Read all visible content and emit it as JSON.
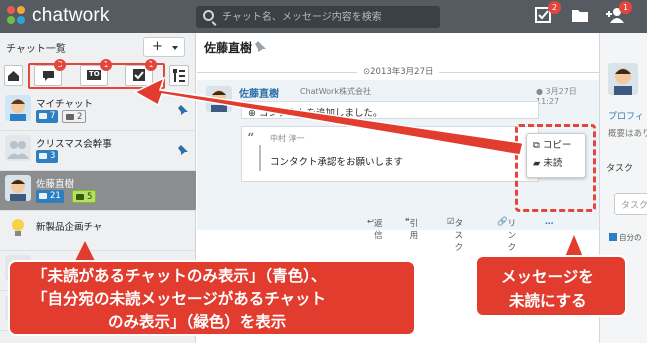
{
  "header": {
    "brand": "chatwork",
    "search_placeholder": "チャット名、メッセージ内容を検索",
    "task_badge": "2",
    "contact_badge": "1"
  },
  "sidebar": {
    "title": "チャット一覧",
    "add_label": "+",
    "filters": [
      {
        "name": "home",
        "badge": ""
      },
      {
        "name": "unread",
        "badge": "3"
      },
      {
        "name": "to",
        "label": "TO",
        "badge": "1"
      },
      {
        "name": "task",
        "badge": "1"
      }
    ],
    "rooms": [
      {
        "name": "マイチャット",
        "unread": "7",
        "task": "2"
      },
      {
        "name": "クリスマス会幹事",
        "unread": "3"
      },
      {
        "name": "佐藤直樹",
        "unread": "21",
        "mention": "5"
      },
      {
        "name": "新製品企画チャ"
      },
      {
        "name": "open"
      },
      {
        "name": ""
      }
    ]
  },
  "main": {
    "room_title": "佐藤直樹",
    "date": "2013年3月27日",
    "message": {
      "sender": "佐藤直樹",
      "company": "ChatWork株式会社",
      "time": "3月27日 11:27",
      "body": "コンタクトを追加しました。",
      "quote_name": "中村 淳一",
      "quote_text": "コンタクト承認をお願いします"
    },
    "actions": {
      "reply": "返信",
      "quote": "引用",
      "task": "タスク",
      "link": "リンク",
      "more": "…"
    }
  },
  "context_menu": {
    "copy": "コピー",
    "unread": "未読"
  },
  "right_panel": {
    "profile_link": "プロフィ",
    "summary": "概要はあり",
    "task_title": "タスク",
    "task_placeholder": "タスク",
    "self_check": "自分の"
  },
  "annotations": {
    "left_line1": "「未読があるチャットのみ表示」（青色）、",
    "left_line2": "「自分宛の未読メッセージがあるチャット",
    "left_line3": "のみ表示」（緑色）を表示",
    "right_line1": "メッセージを",
    "right_line2": "未読にする"
  },
  "colors": {
    "header": "#555b61",
    "accent_blue": "#2d7fc1",
    "accent_green": "#b8dd6a",
    "callout_red": "#e23c2f"
  }
}
